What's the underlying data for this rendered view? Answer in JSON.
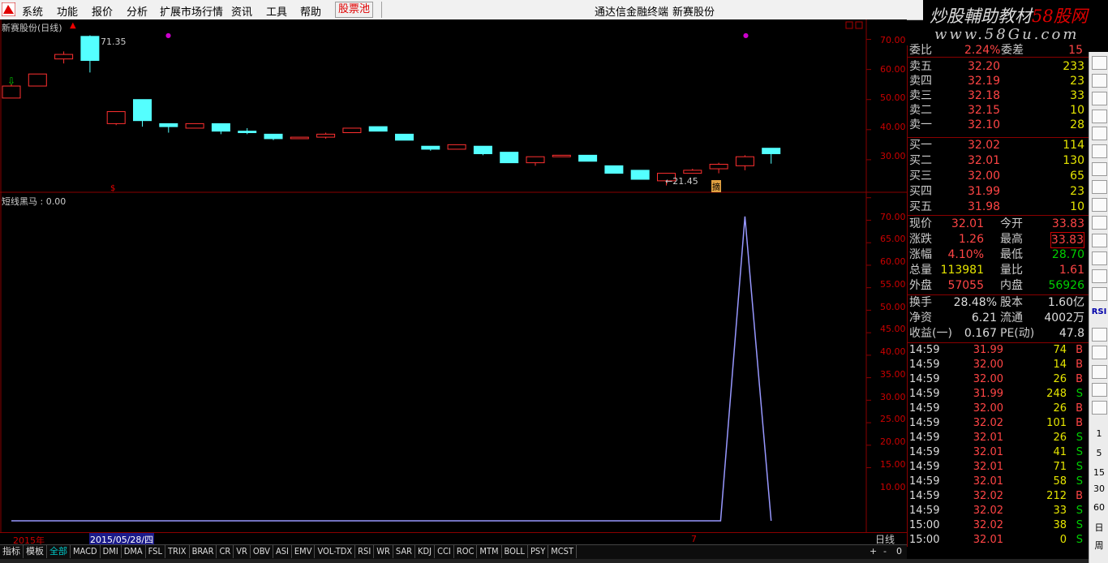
{
  "menu": {
    "items": [
      "系统",
      "功能",
      "报价",
      "分析",
      "扩展市场行情",
      "资讯",
      "工具",
      "帮助"
    ],
    "stock_pool": "股票池",
    "terminal_title": "通达信金融终端",
    "stock_name": "新赛股份"
  },
  "watermark": {
    "line1_a": "炒股輔助教材",
    "line1_b": "58股网",
    "line2": "www.58Gu.com"
  },
  "kline": {
    "title": "新赛股份(日线)",
    "high_label": "71.35",
    "low_label": "←21.45",
    "axis": [
      "70.00",
      "60.00",
      "50.00",
      "40.00",
      "30.00"
    ],
    "marker": "摘"
  },
  "indicator": {
    "title": "短线黑马 : 0.00",
    "axis": [
      "70.00",
      "65.00",
      "60.00",
      "55.00",
      "50.00",
      "45.00",
      "40.00",
      "35.00",
      "30.00",
      "25.00",
      "20.00",
      "15.00",
      "10.00"
    ]
  },
  "dates": {
    "year": "2015年",
    "cursor": "2015/05/28/四",
    "month": "7",
    "period": "日线"
  },
  "tabs": [
    "指标",
    "模板",
    "全部",
    "MACD",
    "DMI",
    "DMA",
    "FSL",
    "TRIX",
    "BRAR",
    "CR",
    "VR",
    "OBV",
    "ASI",
    "EMV",
    "VOL-TDX",
    "RSI",
    "WR",
    "SAR",
    "KDJ",
    "CCI",
    "ROC",
    "MTM",
    "BOLL",
    "PSY",
    "MCST"
  ],
  "tab_controls": [
    "+",
    "-",
    "0"
  ],
  "quote": {
    "weibi": {
      "label": "委比",
      "value": "2.24%",
      "label2": "委差",
      "value2": "15"
    },
    "asks": [
      {
        "label": "卖五",
        "price": "32.20",
        "vol": "233"
      },
      {
        "label": "卖四",
        "price": "32.19",
        "vol": "23"
      },
      {
        "label": "卖三",
        "price": "32.18",
        "vol": "33"
      },
      {
        "label": "卖二",
        "price": "32.15",
        "vol": "10"
      },
      {
        "label": "卖一",
        "price": "32.10",
        "vol": "28"
      }
    ],
    "bids": [
      {
        "label": "买一",
        "price": "32.02",
        "vol": "114"
      },
      {
        "label": "买二",
        "price": "32.01",
        "vol": "130"
      },
      {
        "label": "买三",
        "price": "32.00",
        "vol": "65"
      },
      {
        "label": "买四",
        "price": "31.99",
        "vol": "23"
      },
      {
        "label": "买五",
        "price": "31.98",
        "vol": "10"
      }
    ],
    "stats": [
      {
        "l1": "现价",
        "v1": "32.01",
        "l2": "今开",
        "v2": "33.83"
      },
      {
        "l1": "涨跌",
        "v1": "1.26",
        "l2": "最高",
        "v2": "33.83"
      },
      {
        "l1": "涨幅",
        "v1": "4.10%",
        "l2": "最低",
        "v2": "28.70"
      },
      {
        "l1": "总量",
        "v1": "113981",
        "l2": "量比",
        "v2": "1.61"
      },
      {
        "l1": "外盘",
        "v1": "57055",
        "l2": "内盘",
        "v2": "56926"
      }
    ],
    "fund": [
      {
        "l1": "换手",
        "v1": "28.48%",
        "l2": "股本",
        "v2": "1.60亿"
      },
      {
        "l1": "净资",
        "v1": "6.21",
        "l2": "流通",
        "v2": "4002万"
      },
      {
        "l1": "收益(一)",
        "v1": "0.167",
        "l2": "PE(动)",
        "v2": "47.8"
      }
    ],
    "ticks": [
      {
        "t": "14:59",
        "p": "31.99",
        "v": "74",
        "d": "B"
      },
      {
        "t": "14:59",
        "p": "32.00",
        "v": "14",
        "d": "B"
      },
      {
        "t": "14:59",
        "p": "32.00",
        "v": "26",
        "d": "B"
      },
      {
        "t": "14:59",
        "p": "31.99",
        "v": "248",
        "d": "S"
      },
      {
        "t": "14:59",
        "p": "32.00",
        "v": "26",
        "d": "B"
      },
      {
        "t": "14:59",
        "p": "32.02",
        "v": "101",
        "d": "B"
      },
      {
        "t": "14:59",
        "p": "32.01",
        "v": "26",
        "d": "S"
      },
      {
        "t": "14:59",
        "p": "32.01",
        "v": "41",
        "d": "S"
      },
      {
        "t": "14:59",
        "p": "32.01",
        "v": "71",
        "d": "S"
      },
      {
        "t": "14:59",
        "p": "32.01",
        "v": "58",
        "d": "S"
      },
      {
        "t": "14:59",
        "p": "32.02",
        "v": "212",
        "d": "B"
      },
      {
        "t": "14:59",
        "p": "32.02",
        "v": "33",
        "d": "S"
      },
      {
        "t": "15:00",
        "p": "32.02",
        "v": "38",
        "d": "S"
      },
      {
        "t": "15:00",
        "p": "32.01",
        "v": "0",
        "d": "S"
      }
    ]
  },
  "toolbar_labels": [
    "RSI",
    "1",
    "5",
    "15",
    "30",
    "60",
    "日",
    "周"
  ],
  "chart_data": {
    "type": "candlestick",
    "title": "新赛股份(日线)",
    "ylim": [
      20,
      75
    ],
    "candles": [
      {
        "o": 50.5,
        "c": 54.5,
        "h": 55,
        "l": 50.5,
        "up": true
      },
      {
        "o": 54.5,
        "c": 58.5,
        "h": 58.5,
        "l": 54.5,
        "up": true
      },
      {
        "o": 63.5,
        "c": 65,
        "h": 66,
        "l": 62,
        "up": true
      },
      {
        "o": 71,
        "c": 63,
        "h": 71.35,
        "l": 59,
        "up": false
      },
      {
        "o": 42,
        "c": 46,
        "h": 46,
        "l": 41.5,
        "up": true
      },
      {
        "o": 50,
        "c": 43,
        "h": 50,
        "l": 41,
        "up": false
      },
      {
        "o": 42,
        "c": 41,
        "h": 42,
        "l": 39,
        "up": false
      },
      {
        "o": 40.5,
        "c": 42,
        "h": 42,
        "l": 40.5,
        "up": true
      },
      {
        "o": 42,
        "c": 39.5,
        "h": 42,
        "l": 38.5,
        "up": false
      },
      {
        "o": 39.5,
        "c": 39,
        "h": 40.5,
        "l": 38.5,
        "up": false
      },
      {
        "o": 38.5,
        "c": 37,
        "h": 38.5,
        "l": 36.5,
        "up": false
      },
      {
        "o": 37,
        "c": 37.5,
        "h": 37.5,
        "l": 37,
        "up": true
      },
      {
        "o": 37.5,
        "c": 38.5,
        "h": 39,
        "l": 37,
        "up": true
      },
      {
        "o": 39,
        "c": 40.5,
        "h": 40.5,
        "l": 39,
        "up": true
      },
      {
        "o": 41,
        "c": 39.5,
        "h": 41,
        "l": 39.5,
        "up": false
      },
      {
        "o": 38.5,
        "c": 36.5,
        "h": 38.5,
        "l": 36.5,
        "up": false
      },
      {
        "o": 34.5,
        "c": 33.5,
        "h": 34.5,
        "l": 33,
        "up": false
      },
      {
        "o": 33.5,
        "c": 35,
        "h": 35,
        "l": 33.5,
        "up": true
      },
      {
        "o": 34.5,
        "c": 32,
        "h": 34.5,
        "l": 31.5,
        "up": false
      },
      {
        "o": 32.5,
        "c": 29,
        "h": 32.5,
        "l": 29,
        "up": false
      },
      {
        "o": 29,
        "c": 31,
        "h": 31,
        "l": 28,
        "up": true
      },
      {
        "o": 31,
        "c": 31.5,
        "h": 31.5,
        "l": 31,
        "up": true
      },
      {
        "o": 31.5,
        "c": 29.5,
        "h": 31.5,
        "l": 29.5,
        "up": false
      },
      {
        "o": 28,
        "c": 25.5,
        "h": 28,
        "l": 25.5,
        "up": false
      },
      {
        "o": 26.5,
        "c": 23.5,
        "h": 26.5,
        "l": 23.5,
        "up": false
      },
      {
        "o": 23,
        "c": 25.5,
        "h": 25.5,
        "l": 21.45,
        "up": true
      },
      {
        "o": 25.5,
        "c": 26.5,
        "h": 27,
        "l": 25.5,
        "up": true
      },
      {
        "o": 27,
        "c": 28.5,
        "h": 29,
        "l": 25.5,
        "up": true
      },
      {
        "o": 28,
        "c": 31,
        "h": 31.5,
        "l": 26.5,
        "up": true
      },
      {
        "o": 33.83,
        "c": 32.01,
        "h": 33.83,
        "l": 28.7,
        "up": false
      }
    ],
    "indicator": {
      "name": "短线黑马",
      "ylim": [
        0,
        75
      ],
      "values": [
        0,
        0,
        0,
        0,
        0,
        0,
        0,
        0,
        0,
        0,
        0,
        0,
        0,
        0,
        0,
        0,
        0,
        0,
        0,
        0,
        0,
        0,
        0,
        0,
        0,
        0,
        0,
        0,
        70,
        0
      ]
    }
  }
}
